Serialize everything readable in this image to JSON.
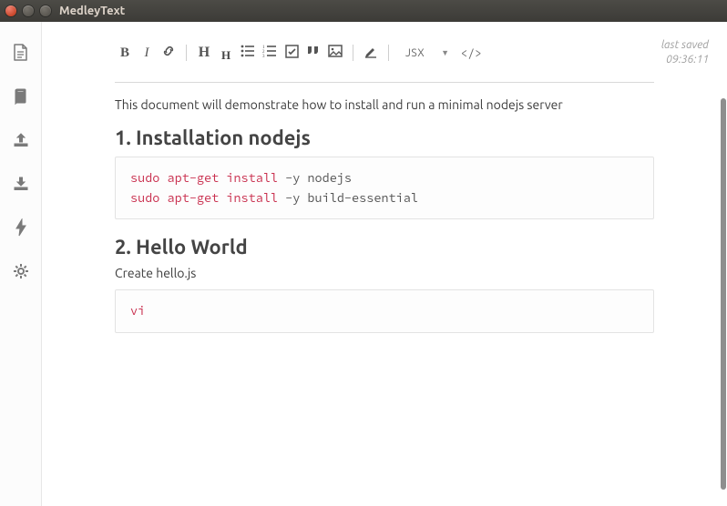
{
  "window": {
    "title": "MedleyText"
  },
  "lastSaved": {
    "label": "last saved",
    "time": "09:36:11"
  },
  "toolbar": {
    "bold": "B",
    "italic": "I",
    "h1": "H",
    "h2": "H",
    "lang": "JSX",
    "code": "</>"
  },
  "doc": {
    "intro": "This document will demonstrate how to install and run a minimal nodejs server",
    "sec1": {
      "heading": "1. Installation nodejs",
      "code": {
        "l1": {
          "sudo": "sudo",
          "aptget": "apt-get",
          "install": "install",
          "rest": " -y nodejs"
        },
        "l2": {
          "sudo": "sudo",
          "aptget": "apt-get",
          "install": "install",
          "rest": " -y build-essential"
        }
      }
    },
    "sec2": {
      "heading": "2. Hello World",
      "para": "Create hello.js",
      "code": {
        "l1": {
          "cmd": "vi"
        }
      }
    }
  }
}
